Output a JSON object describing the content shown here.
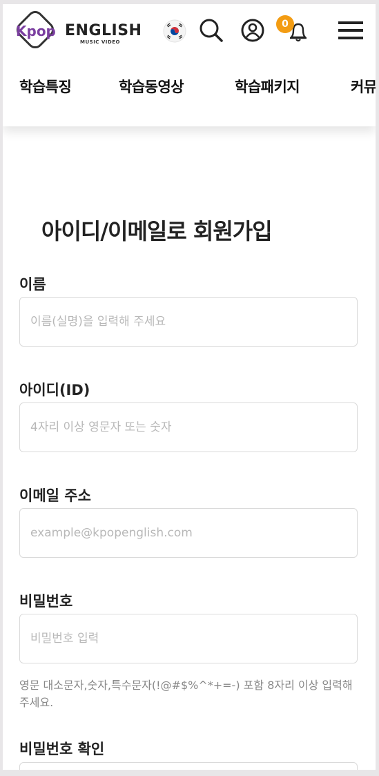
{
  "header": {
    "logo_text": "ENGLISH",
    "logo_subtext": "MUSIC VIDEO",
    "logo_mark_text": "Kpop",
    "notification_count": "0",
    "icons": [
      "korea-flag-icon",
      "search-icon",
      "user-icon",
      "bell-icon",
      "hamburger-menu-icon"
    ]
  },
  "nav": {
    "items": [
      "학습특징",
      "학습동영상",
      "학습패키지",
      "커뮤"
    ]
  },
  "form": {
    "title": "아이디/이메일로 회원가입",
    "fields": [
      {
        "label": "이름",
        "placeholder": "이름(실명)을 입력해 주세요"
      },
      {
        "label": "아이디(ID)",
        "placeholder": "4자리 이상 영문자 또는 숫자"
      },
      {
        "label": "이메일 주소",
        "placeholder": "example@kpopenglish.com"
      },
      {
        "label": "비밀번호",
        "placeholder": "비밀번호 입력"
      },
      {
        "label": "비밀번호 확인",
        "placeholder": ""
      }
    ],
    "password_hint": "영문 대소문자,숫자,특수문자(!@#$%^*+=-) 포함 8자리 이상 입력해주세요."
  },
  "colors": {
    "logo_purple": "#7b3fa0",
    "badge_orange": "#f39c12",
    "text_dark": "#222222",
    "placeholder_gray": "#b8b8b8",
    "border_gray": "#dadada"
  }
}
